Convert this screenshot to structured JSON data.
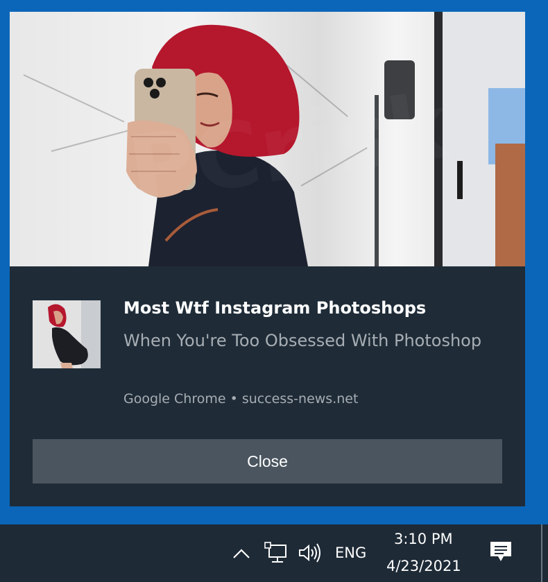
{
  "notification": {
    "title": "Most Wtf Instagram Photoshops",
    "body": "When You're Too Obsessed With Photoshop",
    "attribution": "Google Chrome • success-news.net",
    "close_label": "Close"
  },
  "taskbar": {
    "language": "ENG",
    "time": "3:10 PM",
    "date": "4/23/2021",
    "icons": [
      "chevron-up-icon",
      "network-icon",
      "volume-icon",
      "action-center-icon"
    ]
  },
  "colors": {
    "desktop": "#0b66b9",
    "toast_bg": "#1f2c38",
    "button_bg": "#4a555f",
    "taskbar_bg": "#1e2a36",
    "hair": "#b5172d"
  }
}
